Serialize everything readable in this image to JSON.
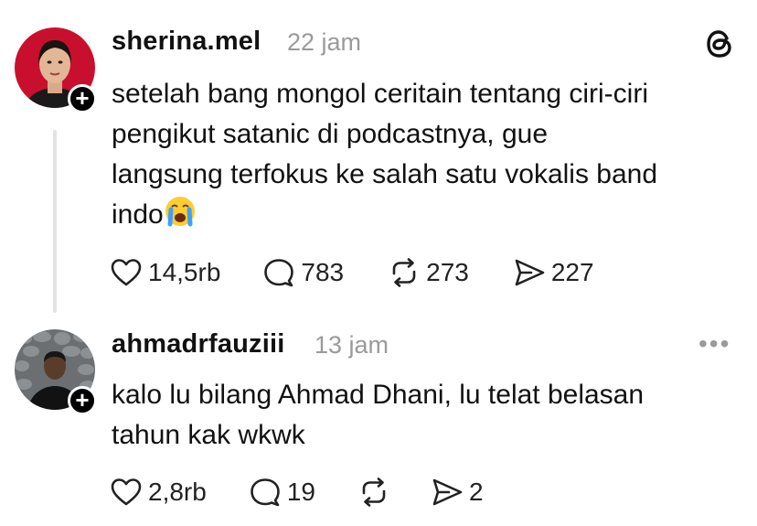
{
  "posts": [
    {
      "username": "sherina.mel",
      "time": "22 jam",
      "text": "setelah bang mongol ceritain tentang ciri-ciri\npengikut satanic di podcastnya, gue\nlangsung terfokus ke salah satu vokalis band\nindo",
      "emoji": "crying-face",
      "likes": "14,5rb",
      "comments": "783",
      "reposts": "273",
      "shares": "227"
    },
    {
      "username": "ahmadrfauziii",
      "time": "13 jam",
      "text": "kalo lu bilang Ahmad Dhani, lu telat belasan\ntahun kak wkwk",
      "likes": "2,8rb",
      "comments": "19",
      "reposts": "",
      "shares": "2",
      "more": "•••"
    }
  ],
  "icons": {
    "like": "heart-icon",
    "comment": "comment-bubble-icon",
    "repost": "repost-icon",
    "share": "send-icon",
    "brand": "threads-logo-icon",
    "follow": "plus-icon"
  },
  "colors": {
    "text": "#111111",
    "muted": "#9a9a9a",
    "thread_line": "#e3e3e3",
    "avatar1_bg": "#c8102e"
  }
}
